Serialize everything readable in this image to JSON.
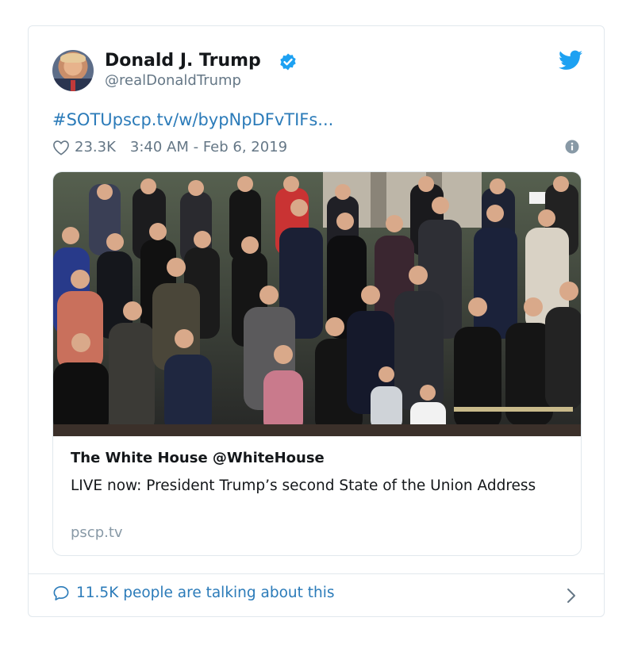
{
  "author": {
    "name": "Donald J. Trump",
    "handle": "@realDonaldTrump"
  },
  "tweet": {
    "text": "#SOTUpscp.tv/w/bypNpDFvTIFs...",
    "likes": "23.3K",
    "timestamp": "3:40 AM - Feb 6, 2019"
  },
  "link_card": {
    "title": "The White House @WhiteHouse",
    "description": "LIVE now: President Trump’s second State of the Union Address",
    "domain": "pscp.tv"
  },
  "footer": {
    "conversation": "11.5K people are talking about this"
  },
  "icons": {
    "verified": "verified-badge-icon",
    "bird": "twitter-bird-icon",
    "heart": "heart-icon",
    "info": "info-icon",
    "bubble": "reply-bubble-icon",
    "chevron": "chevron-right-icon"
  },
  "colors": {
    "link": "#2b7bb9",
    "twitter_blue": "#1da1f2",
    "muted": "#657786"
  }
}
